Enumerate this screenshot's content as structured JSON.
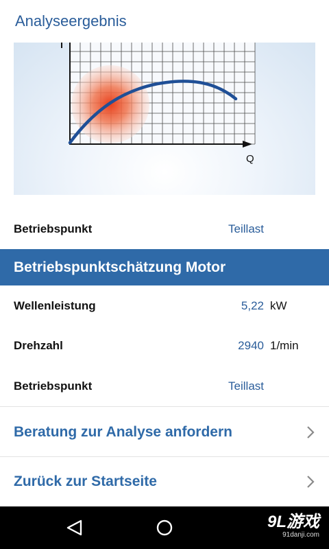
{
  "header": {
    "title": "Analyseergebnis"
  },
  "chart": {
    "x_axis_label": "Q",
    "colors": {
      "curve": "#1f4f96",
      "hotspot": "#e8401c",
      "grid": "#3a3a3a"
    }
  },
  "operating_point": {
    "label": "Betriebspunkt",
    "value": "Teillast"
  },
  "section": {
    "title": "Betriebspunktschätzung Motor"
  },
  "motor": {
    "rows": [
      {
        "label": "Wellenleistung",
        "value": "5,22",
        "unit": "kW"
      },
      {
        "label": "Drehzahl",
        "value": "2940",
        "unit": "1/min"
      },
      {
        "label": "Betriebspunkt",
        "value": "Teillast",
        "unit": ""
      }
    ]
  },
  "links": [
    {
      "label": "Beratung zur Analyse anfordern",
      "icon": "chevron-right-icon"
    },
    {
      "label": "Zurück zur Startseite",
      "icon": "chevron-right-icon"
    }
  ],
  "navbar": {
    "icons": [
      "back-triangle-icon",
      "home-circle-icon"
    ],
    "watermark": {
      "main": "9L游戏",
      "sub": "91danji.com"
    }
  }
}
